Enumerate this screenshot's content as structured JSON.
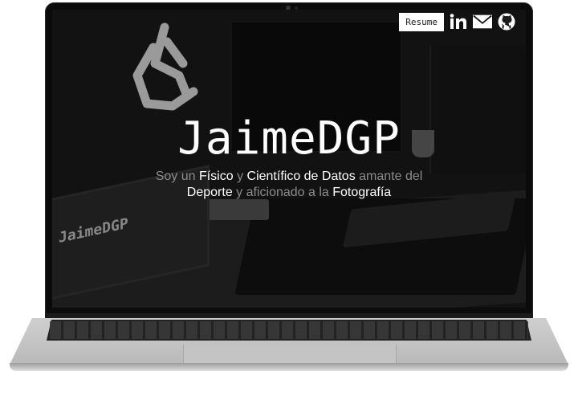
{
  "nav": {
    "resume_label": "Resume",
    "icons": [
      "linkedin-icon",
      "mail-icon",
      "github-icon"
    ]
  },
  "hero": {
    "title": "JaimeDGP",
    "subtitle": {
      "p1": "Soy un ",
      "h1": "Físico",
      "p2": " y ",
      "h2": "Científico de Datos",
      "p3": " amante del ",
      "h3": "Deporte",
      "p4": " y aficionado a la ",
      "h4": "Fotografía"
    }
  },
  "background": {
    "mini_laptop_title": "JaimeDGP"
  },
  "colors": {
    "highlight": "#ffffff",
    "muted_text": "#8c8c8c",
    "screen_bg": "#1c1c1c"
  }
}
